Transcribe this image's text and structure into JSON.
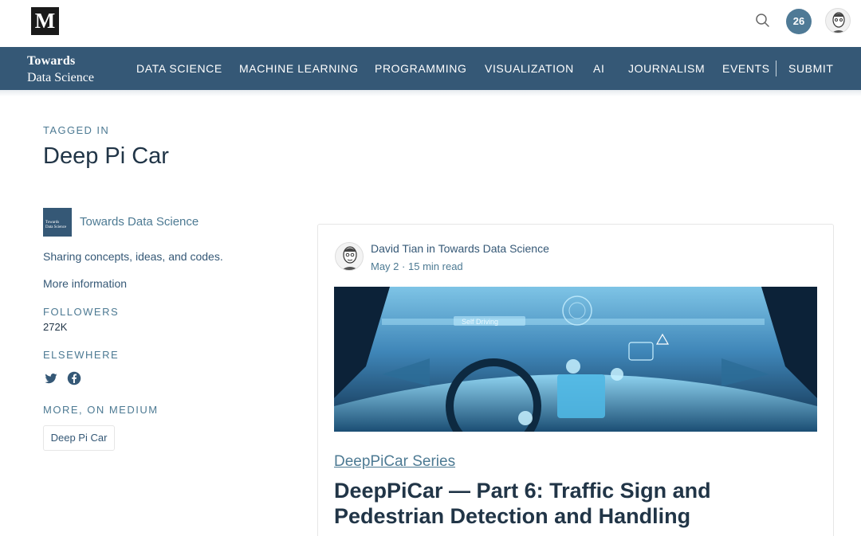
{
  "header": {
    "logo_letter": "M",
    "notification_count": "26"
  },
  "brand": {
    "line1": "Towards",
    "line2": "Data Science"
  },
  "nav": {
    "items": [
      "DATA SCIENCE",
      "MACHINE LEARNING",
      "PROGRAMMING",
      "VISUALIZATION",
      "AI",
      "JOURNALISM",
      "EVENTS"
    ],
    "submit": "SUBMIT"
  },
  "tag": {
    "tagged_in_label": "TAGGED IN",
    "title": "Deep Pi Car"
  },
  "sidebar": {
    "publication_name": "Towards Data Science",
    "logo_text_1": "Towards",
    "logo_text_2": "Data Science",
    "description": "Sharing concepts, ideas, and codes.",
    "more_info": "More information",
    "followers_label": "FOLLOWERS",
    "followers_count": "272K",
    "elsewhere_label": "ELSEWHERE",
    "social_icons": [
      "twitter-icon",
      "facebook-icon"
    ],
    "more_label": "MORE, ON MEDIUM",
    "tag_chip": "Deep Pi Car"
  },
  "post": {
    "author": "David Tian",
    "in_word": "in",
    "publication": "Towards Data Science",
    "date": "May 2",
    "separator": "·",
    "read_time": "15 min read",
    "series": "DeepPiCar Series",
    "title": "DeepPiCar — Part 6: Traffic Sign and Pedestrian Detection and Handling",
    "hero_overlay_text": "Self Driving"
  },
  "colors": {
    "nav_background": "#355876",
    "accent": "#4f7a96",
    "title_text": "#213547"
  }
}
